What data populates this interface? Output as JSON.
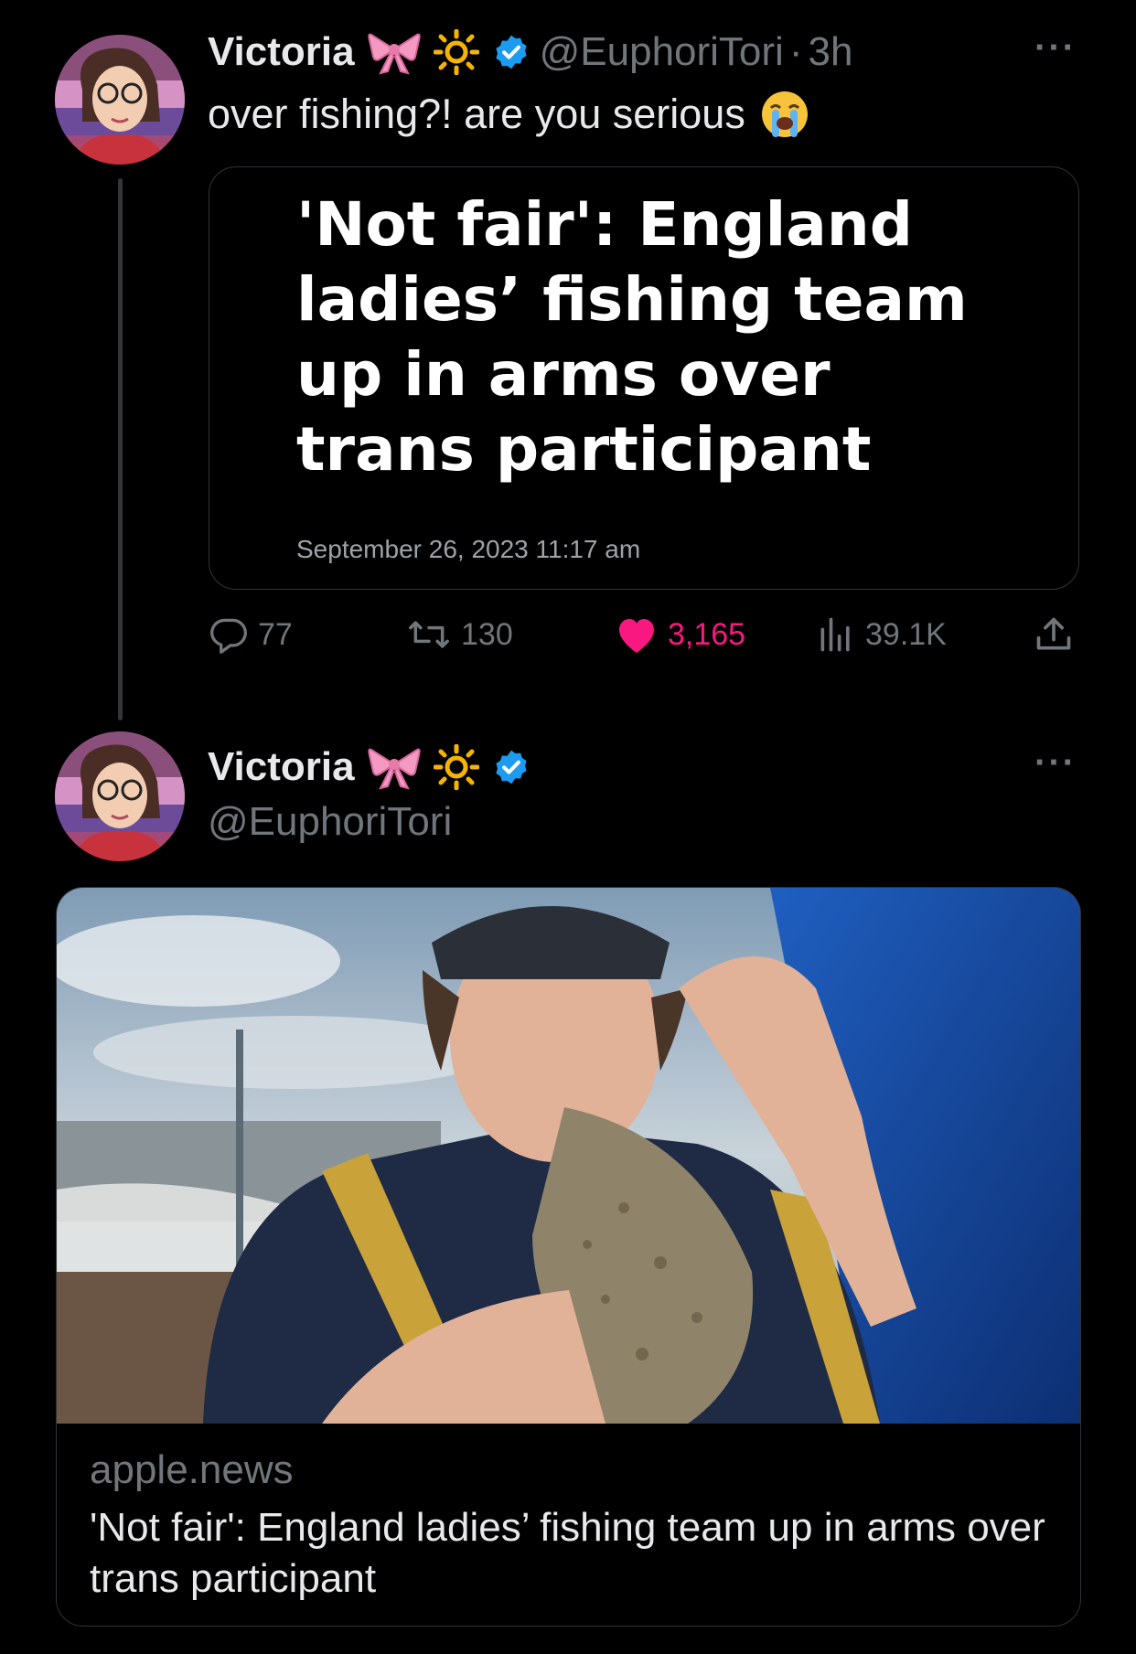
{
  "tweet1": {
    "display_name": "Victoria",
    "emoji_1": "🎀",
    "emoji_2": "🔆",
    "handle": "@EuphoriTori",
    "separator": "·",
    "time": "3h",
    "text": "over fishing?! are you serious",
    "text_emoji": "😭",
    "more": "···",
    "quote": {
      "headline": "'Not fair': England ladies’ fishing team up in arms over trans participant",
      "date": "September 26, 2023 11:17 am"
    },
    "stats": {
      "replies": "77",
      "retweets": "130",
      "likes": "3,165",
      "views": "39.1K"
    },
    "icons": {
      "reply": "reply-icon",
      "retweet": "retweet-icon",
      "like": "heart-icon",
      "views": "views-icon",
      "share": "share-icon",
      "verified": "verified-badge-icon"
    },
    "colors": {
      "like": "#f91880",
      "verified": "#1d9bf0",
      "muted": "#71767b"
    }
  },
  "tweet2": {
    "display_name": "Victoria",
    "emoji_1": "🎀",
    "emoji_2": "🔆",
    "handle": "@EuphoriTori",
    "more": "···",
    "link_card": {
      "domain": "apple.news",
      "title": "'Not fair': England ladies’ fishing team up in arms over trans participant"
    }
  }
}
